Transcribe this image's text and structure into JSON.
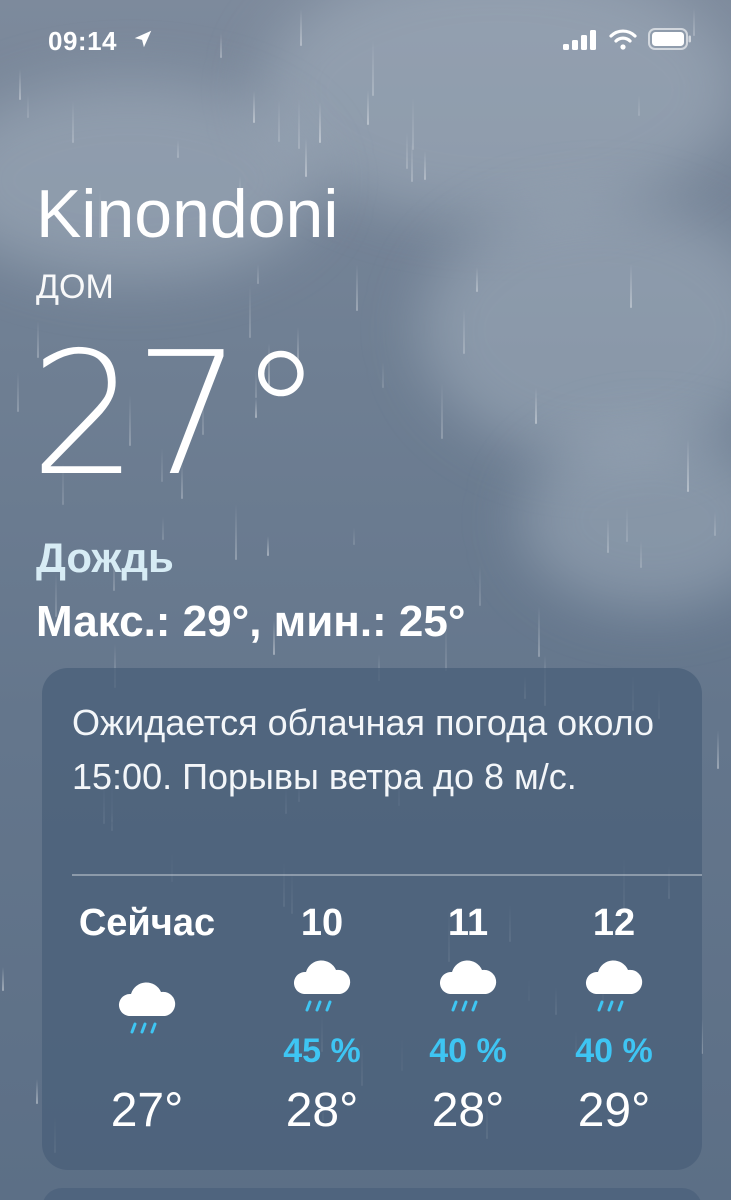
{
  "status_bar": {
    "time": "09:14"
  },
  "location": {
    "city": "Kinondoni",
    "label": "ДОМ"
  },
  "current": {
    "temperature": "27°",
    "condition": "Дождь",
    "high_low": "Макс.: 29°, мин.: 25°"
  },
  "forecast_card": {
    "summary": "Ожидается облачная погода около 15:00. Порывы ветра до 8 м/с.",
    "hours": [
      {
        "label": "Сейчас",
        "icon": "rain-cloud-icon",
        "precip": "",
        "temp": "27°"
      },
      {
        "label": "10",
        "icon": "rain-cloud-icon",
        "precip": "45 %",
        "temp": "28°"
      },
      {
        "label": "11",
        "icon": "rain-cloud-icon",
        "precip": "40 %",
        "temp": "28°"
      },
      {
        "label": "12",
        "icon": "rain-cloud-icon",
        "precip": "40 %",
        "temp": "29°"
      }
    ]
  },
  "colors": {
    "precip_accent": "#3ec5f3",
    "condition_tint": "#d7ecf5"
  }
}
